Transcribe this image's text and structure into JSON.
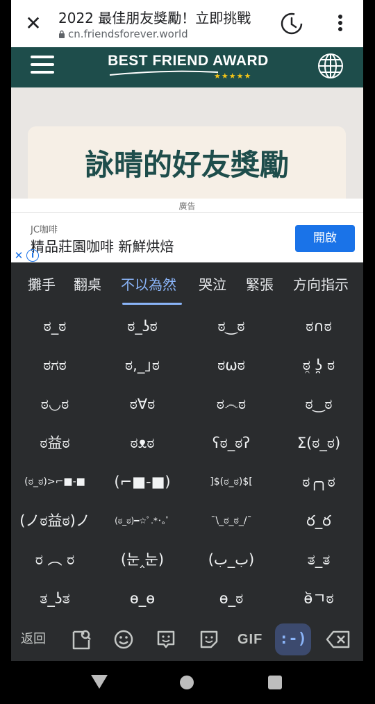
{
  "browser": {
    "title": "2022 最佳朋友獎勵！立即挑戰",
    "url": "cn.friendsforever.world"
  },
  "site": {
    "brand": "BEST FRIEND AWARD",
    "stars": "★★★★★",
    "card_title": "詠晴的好友獎勵"
  },
  "ad": {
    "label": "廣告",
    "advertiser": "JC咖啡",
    "headline": "精品莊園咖啡 新鮮烘焙",
    "cta": "開啟"
  },
  "keyboard": {
    "tabs": [
      "攤手",
      "翻桌",
      "不以為然",
      "哭泣",
      "緊張",
      "方向指示"
    ],
    "active_tab": 2,
    "emoticons": [
      [
        "ಠ_ಠ",
        "ಠ_ʖಠ",
        "ಠ‿ಠ",
        "ಠ∩ಠ"
      ],
      [
        "ಠಗಠ",
        "ಠ,_｣ಠ",
        "ಠωಠ",
        "ಠ̯ ʖ̯ ಠ"
      ],
      [
        "ಠ◡ಠ",
        "ಠ∀ಠ",
        "ಠ෴ಠ",
        "ಠ‿ಠ"
      ],
      [
        "ಠ益ಠ",
        "ಠᴥಠ",
        "ʕಠ_ಠʔ",
        "Σ(ಠ_ಠ)"
      ],
      [
        "(ಠ_ಠ)>⌐■-■",
        "(⌐■-■)",
        "]$(ಠ_ಠ)$[",
        "ಠ╭╮ಠ"
      ],
      [
        "(ノಠ益ಠ)ノ",
        "(ಠ_ಠ)━☆ﾟ.*･｡ﾟ",
        "¯\\_ಠ_ಠ_/¯",
        "ర_ర"
      ],
      [
        "ರ ︵ ರ",
        "(눈‸눈)",
        "(ب_ب)",
        "ತ_ತ"
      ],
      [
        "ತ_ʖತ",
        "ɵ_ɵ",
        "ɵ_ಠ",
        "ɵ᷅ㄱಠ"
      ]
    ],
    "bottom": {
      "back": "返回",
      "gif": "GIF",
      "emoticon": ":-)"
    }
  },
  "colors": {
    "site_header": "#1e4d4b",
    "accent_blue": "#1a73e8",
    "keyboard_bg": "#2a2c2e",
    "active_tab": "#8ab4f8"
  }
}
